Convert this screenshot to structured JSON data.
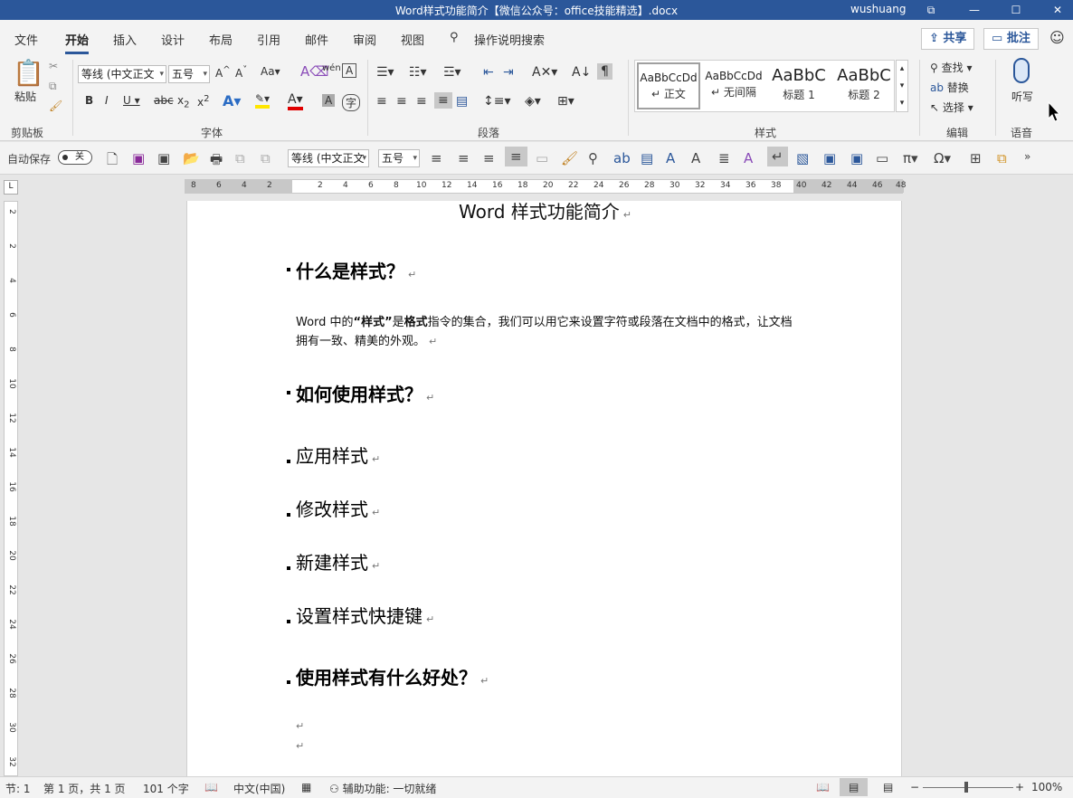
{
  "window": {
    "title": "Word样式功能简介【微信公众号：office技能精选】.docx",
    "user": "wushuang",
    "controls": [
      "⧉",
      "—",
      "☐",
      "✕"
    ]
  },
  "tabs": [
    "文件",
    "开始",
    "插入",
    "设计",
    "布局",
    "引用",
    "邮件",
    "审阅",
    "视图"
  ],
  "active_tab": "开始",
  "tell_me": "操作说明搜索",
  "share_label": "共享",
  "comment_label": "批注",
  "ribbon": {
    "clipboard": {
      "paste": "粘贴",
      "label": "剪贴板"
    },
    "font": {
      "label": "字体",
      "font_name": "等线 (中文正文",
      "font_size": "五号",
      "glyphs": [
        "A^",
        "A˅",
        "Aa",
        "wén",
        "A",
        "B",
        "I",
        "U",
        "abc",
        "x₂",
        "x²",
        "A",
        "A",
        "A"
      ]
    },
    "paragraph": {
      "label": "段落"
    },
    "styles": {
      "label": "样式",
      "items": [
        {
          "preview": "AaBbCcDd",
          "name": "正文"
        },
        {
          "preview": "AaBbCcDd",
          "name": "无间隔"
        },
        {
          "preview": "AaBbC",
          "name": "标题 1"
        },
        {
          "preview": "AaBbC",
          "name": "标题 2"
        }
      ]
    },
    "editing": {
      "label": "编辑",
      "find": "查找",
      "replace": "替换",
      "select": "选择"
    },
    "voice": {
      "label": "语音",
      "dictate": "听写"
    }
  },
  "qat": {
    "autosave_label": "自动保存",
    "autosave_state": "关",
    "font_name": "等线 (中文正文",
    "font_size": "五号"
  },
  "ruler": {
    "h_marks": [
      "8",
      "6",
      "4",
      "2",
      "2",
      "4",
      "6",
      "8",
      "10",
      "12",
      "14",
      "16",
      "18",
      "20",
      "22",
      "24",
      "26",
      "28",
      "30",
      "32",
      "34",
      "36",
      "38",
      "40",
      "42",
      "44",
      "46",
      "48"
    ],
    "v_marks": [
      "2",
      "2",
      "4",
      "6",
      "8",
      "10",
      "12",
      "14",
      "16",
      "18",
      "20",
      "22",
      "24",
      "26",
      "28",
      "30",
      "32"
    ],
    "corner": "L"
  },
  "document": {
    "title": "Word 样式功能简介",
    "h1_what": "什么是样式？",
    "body_parts": [
      "Word 中的",
      "“样式”",
      "是",
      "格式",
      "指令的集合，我们可以用它来设置字符或段落在文档中的格式，让文档拥有一致、精美的外观。"
    ],
    "h1_how": "如何使用样式？",
    "h2_items": [
      "应用样式",
      "修改样式",
      "新建样式",
      "设置样式快捷键"
    ],
    "h1_why": "使用样式有什么好处？",
    "para_mark": "↵"
  },
  "status": {
    "section": "节: 1",
    "page": "第 1 页，共 1 页",
    "words": "101 个字",
    "lang": "中文(中国)",
    "accessibility": "辅助功能: 一切就绪",
    "zoom": "100%"
  },
  "colors": {
    "title_bar": "#2b579a",
    "accent": "#2b579a"
  }
}
